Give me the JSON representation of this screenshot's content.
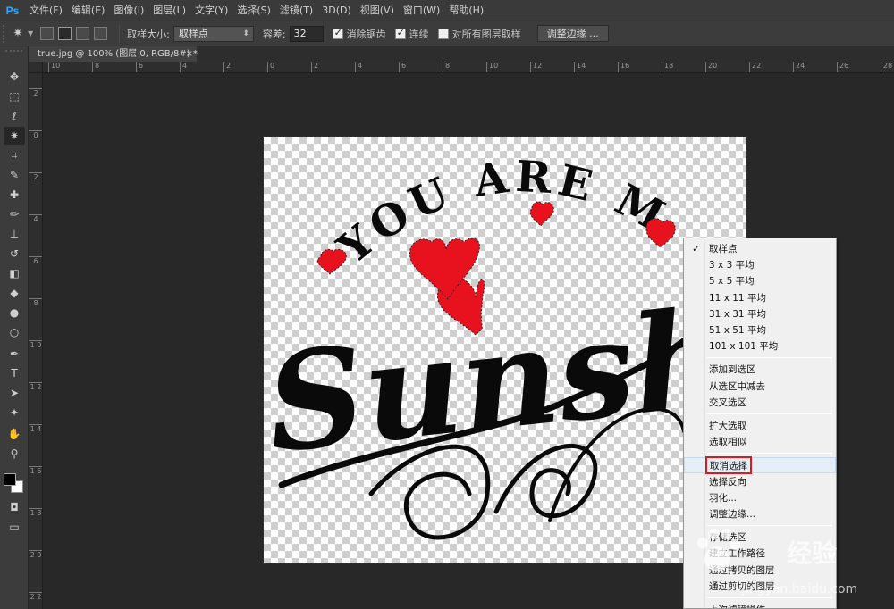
{
  "app": {
    "logo": "Ps"
  },
  "menubar": {
    "items": [
      "文件(F)",
      "编辑(E)",
      "图像(I)",
      "图层(L)",
      "文字(Y)",
      "选择(S)",
      "滤镜(T)",
      "3D(D)",
      "视图(V)",
      "窗口(W)",
      "帮助(H)"
    ]
  },
  "options": {
    "sample_size_label": "取样大小:",
    "sample_size_value": "取样点",
    "tolerance_label": "容差:",
    "tolerance_value": "32",
    "antialias_label": "消除锯齿",
    "antialias_checked": true,
    "contiguous_label": "连续",
    "contiguous_checked": true,
    "all_layers_label": "对所有图层取样",
    "all_layers_checked": false,
    "refine_edge_label": "调整边缘 ..."
  },
  "document_tab": {
    "title": "true.jpg @ 100% (图层 0, RGB/8#) *",
    "close": "×"
  },
  "ruler_h_labels": [
    "10",
    "8",
    "6",
    "4",
    "2",
    "0",
    "2",
    "4",
    "6",
    "8",
    "10",
    "12",
    "14",
    "16",
    "18",
    "20",
    "22",
    "24",
    "26",
    "28"
  ],
  "ruler_v_labels": [
    "2",
    "0",
    "2",
    "4",
    "6",
    "8",
    "1 0",
    "1 2",
    "1 4",
    "1 6",
    "1 8",
    "2 0",
    "2 2"
  ],
  "artwork": {
    "line1": "YOU ARE MY",
    "line2": "Sunshine",
    "heart_color": "#e8121f",
    "ink_color": "#0a0a0a"
  },
  "context_menu": {
    "groups": [
      [
        "取样点",
        "3 x 3 平均",
        "5 x 5 平均",
        "11 x 11 平均",
        "31 x 31 平均",
        "51 x 51 平均",
        "101 x 101 平均"
      ],
      [
        "添加到选区",
        "从选区中减去",
        "交叉选区"
      ],
      [
        "扩大选取",
        "选取相似"
      ],
      [
        "取消选择",
        "选择反向",
        "羽化...",
        "调整边缘..."
      ],
      [
        "存储选区",
        "建立工作路径",
        "通过拷贝的图层",
        "通过剪切的图层"
      ],
      [
        "上次滤镜操作"
      ]
    ],
    "checked_item": "取样点",
    "highlighted_item": "取消选择",
    "highlight_color": "#e3161a"
  },
  "watermark": {
    "brand": "Baidu",
    "text": "经验",
    "url": "jingyan.baidu.com"
  }
}
